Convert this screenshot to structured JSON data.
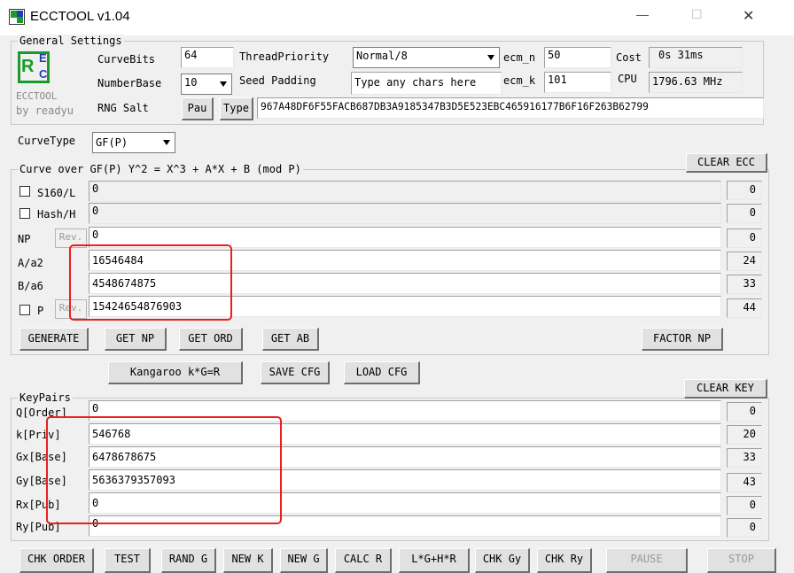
{
  "window": {
    "title": "ECCTOOL v1.04",
    "minimize": "—",
    "maximize": "☐",
    "close": "✕"
  },
  "general": {
    "group_title": "General Settings",
    "logo_letters": [
      "R",
      "E",
      "C"
    ],
    "app_name": "ECCTOOL",
    "by_line": "by readyu",
    "curvebits_label": "CurveBits",
    "curvebits_value": "64",
    "threadpriority_label": "ThreadPriority",
    "threadpriority_value": "Normal/8",
    "ecm_n_label": "ecm_n",
    "ecm_n_value": "50",
    "cost_label": "Cost",
    "cost_value": "0s 31ms",
    "numberbase_label": "NumberBase",
    "numberbase_value": "10",
    "seedpadding_label": "Seed Padding",
    "seedpadding_placeholder": "Type any chars here",
    "ecm_k_label": "ecm_k",
    "ecm_k_value": "101",
    "cpu_label": "CPU",
    "cpu_value": "1796.63 MHz",
    "rngsalt_label": "RNG Salt",
    "pau_button": "Pau",
    "type_button": "Type",
    "rngsalt_value": "967A48DF6F55FACB687DB3A9185347B3D5E523EBC465916177B6F16F263B62799"
  },
  "curve": {
    "curvetype_label": "CurveType",
    "curvetype_value": "GF(P)",
    "group_title": "Curve over GF(P) Y^2 = X^3 + A*X + B (mod P)",
    "clear_button": "CLEAR ECC",
    "rows": [
      {
        "label": "S160/L",
        "value": "0",
        "count": "0"
      },
      {
        "label": "Hash/H",
        "value": "0",
        "count": "0"
      },
      {
        "label": "NP",
        "rev": "Rev.",
        "value": "0",
        "count": "0"
      },
      {
        "label": "A/a2",
        "value": "16546484",
        "count": "24"
      },
      {
        "label": "B/a6",
        "value": "4548674875",
        "count": "33"
      },
      {
        "label": "P",
        "rev": "Rev.",
        "value": "15424654876903",
        "count": "44"
      }
    ],
    "buttons": {
      "generate": "GENERATE",
      "get_np": "GET NP",
      "get_ord": "GET ORD",
      "get_ab": "GET AB",
      "factor_np": "FACTOR NP",
      "kangaroo": "Kangaroo k*G=R",
      "save_cfg": "SAVE CFG",
      "load_cfg": "LOAD CFG"
    }
  },
  "keypairs": {
    "group_title": "KeyPairs",
    "clear_button": "CLEAR KEY",
    "rows": [
      {
        "label": "Q[Order]",
        "value": "0",
        "count": "0"
      },
      {
        "label": "k[Priv]",
        "value": "546768",
        "count": "20"
      },
      {
        "label": "Gx[Base]",
        "value": "6478678675",
        "count": "33"
      },
      {
        "label": "Gy[Base]",
        "value": "5636379357093",
        "count": "43"
      },
      {
        "label": "Rx[Pub]",
        "value": "0",
        "count": "0"
      },
      {
        "label": "Ry[Pub]",
        "value": "0",
        "count": "0"
      }
    ],
    "buttons": {
      "chk_order": "CHK ORDER",
      "test": "TEST",
      "rand_g": "RAND G",
      "new_k": "NEW K",
      "new_g": "NEW G",
      "calc_r": "CALC R",
      "lgh": "L*G+H*R",
      "chk_gy": "CHK Gy",
      "chk_ry": "CHK Ry",
      "pause": "PAUSE",
      "stop": "STOP"
    }
  },
  "colors": {
    "highlight": "#e8201f",
    "window_bg": "#f0f0f0",
    "logo_green": "#1a9a2a",
    "logo_blue": "#1f3fb8"
  }
}
